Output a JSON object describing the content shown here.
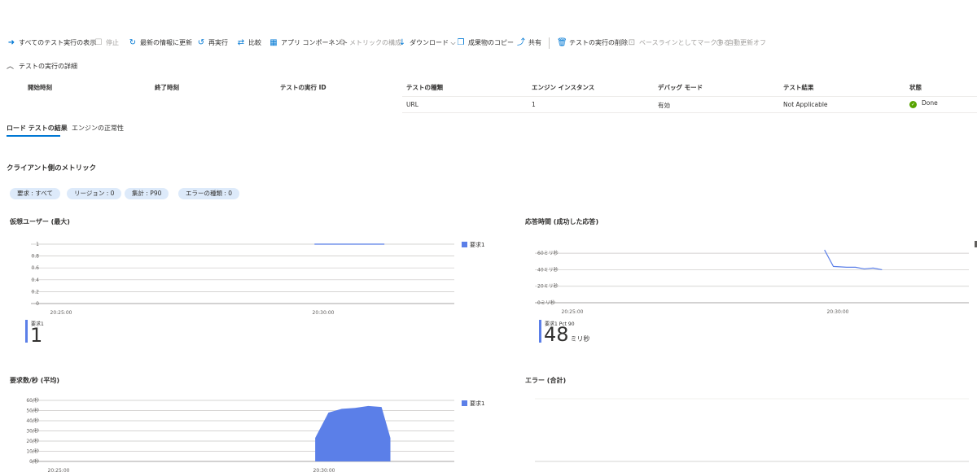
{
  "toolbar": {
    "items": [
      {
        "label": "すべてのテスト実行の表示",
        "icon": "arrow-right-circle-icon",
        "disabled": false
      },
      {
        "label": "停止",
        "icon": "stop-square-icon",
        "disabled": true
      },
      {
        "label": "最新の情報に更新",
        "icon": "refresh-icon",
        "disabled": false
      },
      {
        "label": "再実行",
        "icon": "rerun-icon",
        "disabled": false
      },
      {
        "label": "比較",
        "icon": "compare-icon",
        "disabled": false
      },
      {
        "label": "アプリ コンポーネント",
        "icon": "app-components-icon",
        "disabled": false
      },
      {
        "label": "メトリックの構成",
        "icon": "gear-icon",
        "disabled": true
      },
      {
        "label": "ダウンロード",
        "icon": "download-icon",
        "disabled": false
      },
      {
        "label": "成果物のコピー",
        "icon": "copy-icon",
        "disabled": false
      },
      {
        "label": "共有",
        "icon": "share-icon",
        "disabled": false
      },
      {
        "label": "テストの実行の削除",
        "icon": "trash-icon",
        "disabled": false
      },
      {
        "label": "ベースラインとしてマークする",
        "icon": "baseline-icon",
        "disabled": true
      },
      {
        "label": "自動更新オフ",
        "icon": "clock-icon",
        "disabled": true
      }
    ]
  },
  "details": {
    "section_title": "テストの実行の詳細",
    "headers": [
      "開始時刻",
      "終了時刻",
      "テストの実行 ID",
      "テストの種類",
      "エンジン インスタンス",
      "デバッグ モード",
      "テスト結果",
      "状態"
    ],
    "row": {
      "test_type": "URL",
      "engine_instances": "1",
      "debug_mode": "有効",
      "test_result": "Not Applicable",
      "status": "Done"
    }
  },
  "tabs": [
    {
      "label": "ロード テストの結果",
      "active": true
    },
    {
      "label": "エンジンの正常性",
      "active": false
    }
  ],
  "client_metrics": {
    "title": "クライアント側のメトリック",
    "filters": [
      "要求 : すべて",
      "リージョン : 0",
      "集計 : P90",
      "エラーの種類 : 0"
    ]
  },
  "chart_data": [
    {
      "type": "line",
      "title": "仮想ユーザー (最大)",
      "x_ticks": [
        "20:25:00",
        "20:30:00"
      ],
      "y_ticks": [
        "0",
        "0.2",
        "0.4",
        "0.6",
        "0.8",
        "1"
      ],
      "ylim": [
        0,
        1
      ],
      "series": [
        {
          "name": "要求1",
          "color": "#5b7fe8",
          "points": [
            [
              "20:29:50",
              1
            ],
            [
              "20:31:10",
              1
            ]
          ]
        }
      ],
      "kpi": {
        "label": "要求1",
        "value": "1",
        "unit": ""
      }
    },
    {
      "type": "line",
      "title": "応答時間 (成功した応答)",
      "x_ticks": [
        "20:25:00",
        "20:30:00"
      ],
      "y_ticks": [
        "0ミリ秒",
        "20ミリ秒",
        "40ミリ秒",
        "60ミリ秒"
      ],
      "ylim": [
        0,
        70
      ],
      "series": [
        {
          "name": "",
          "color": "#5b7fe8",
          "points": [
            [
              "20:29:45",
              64
            ],
            [
              "20:29:55",
              44
            ],
            [
              "20:30:10",
              43
            ],
            [
              "20:30:20",
              43
            ],
            [
              "20:30:30",
              41
            ],
            [
              "20:30:40",
              42
            ],
            [
              "20:30:50",
              40
            ]
          ]
        }
      ],
      "kpi": {
        "label": "要求1 Pct 90",
        "value": "48",
        "unit": "ミリ秒"
      }
    },
    {
      "type": "area",
      "title": "要求数/秒 (平均)",
      "x_ticks": [
        "20:25:00",
        "20:30:00"
      ],
      "y_ticks": [
        "0/秒",
        "10/秒",
        "20/秒",
        "30/秒",
        "40/秒",
        "50/秒",
        "60/秒"
      ],
      "ylim": [
        0,
        65
      ],
      "series": [
        {
          "name": "要求1",
          "color": "#5b7fe8",
          "points": [
            [
              "20:29:50",
              25
            ],
            [
              "20:30:05",
              52
            ],
            [
              "20:30:20",
              56
            ],
            [
              "20:30:35",
              57
            ],
            [
              "20:30:50",
              59
            ],
            [
              "20:31:05",
              58
            ],
            [
              "20:31:15",
              25
            ]
          ]
        }
      ]
    },
    {
      "type": "line",
      "title": "エラー (合計)",
      "series": []
    }
  ]
}
